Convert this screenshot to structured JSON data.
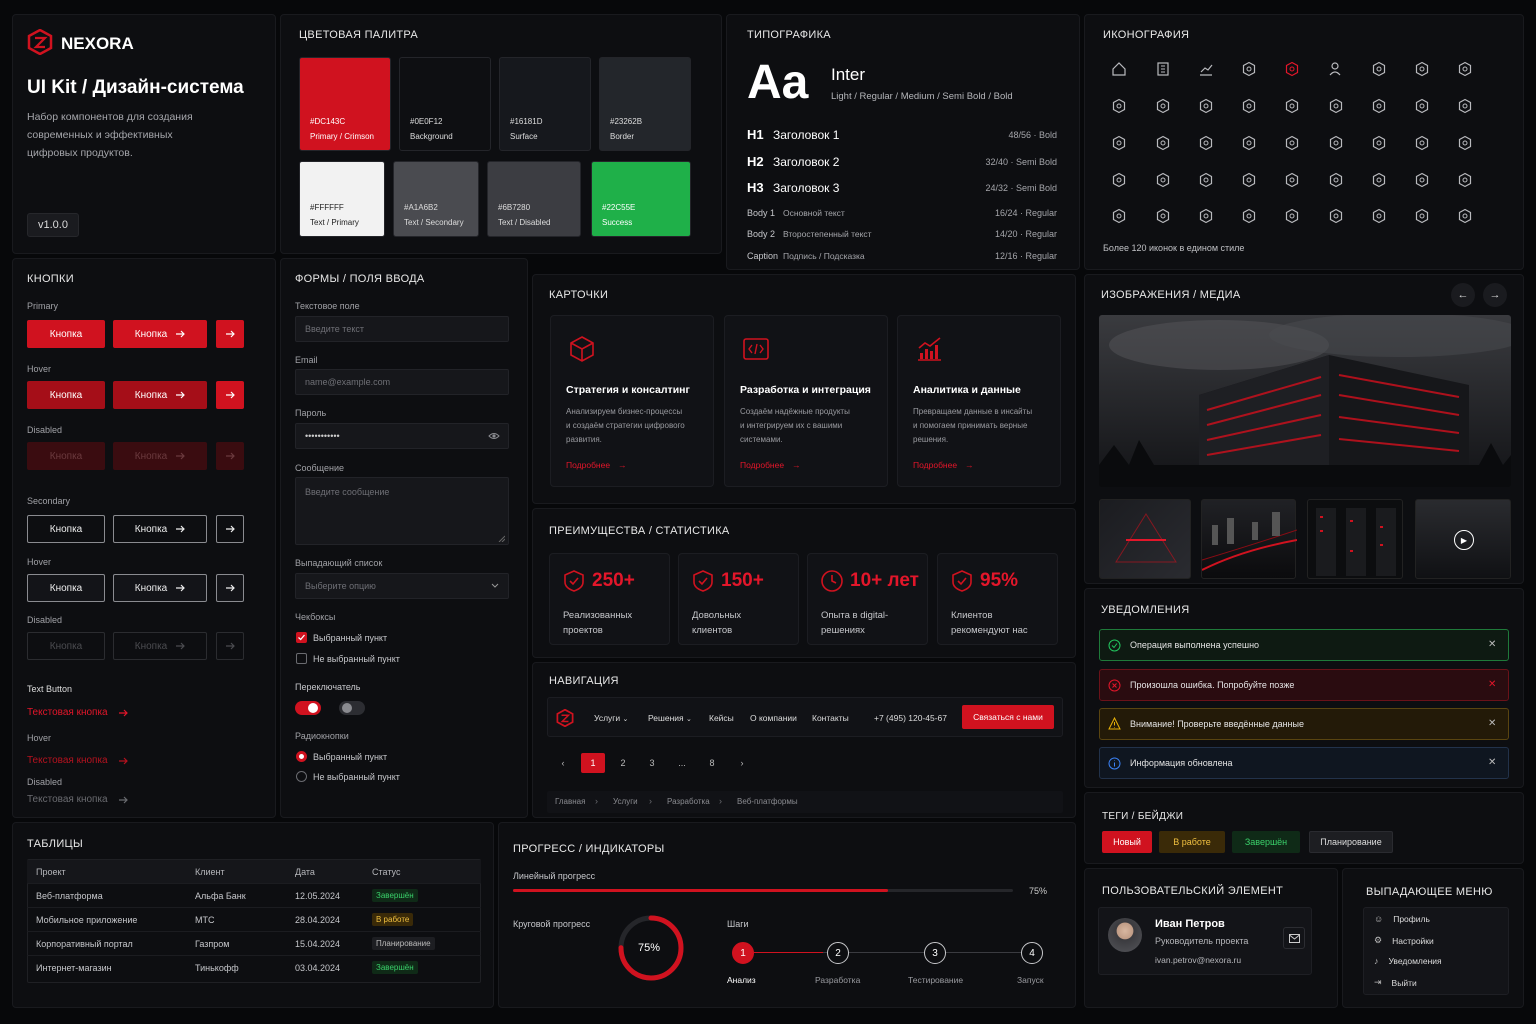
{
  "brand": {
    "name": "NEXORA",
    "title": "UI Kit / Дизайн-система",
    "description_lines": [
      "Набор компонентов для создания",
      "современных и эффективных",
      "цифровых продуктов."
    ],
    "version": "v1.0.0"
  },
  "palette": {
    "title": "ЦВЕТОВАЯ ПАЛИТРА",
    "swatches": [
      {
        "hex": "#DC143C",
        "name": "Primary / Crimson",
        "color": "#d0121f",
        "fg": "#fff"
      },
      {
        "hex": "#0E0F12",
        "name": "Background",
        "color": "#0e0f12",
        "fg": "#ddd"
      },
      {
        "hex": "#16181D",
        "name": "Surface",
        "color": "#16181d",
        "fg": "#ddd"
      },
      {
        "hex": "#23262B",
        "name": "Border",
        "color": "#23262b",
        "fg": "#ddd"
      },
      {
        "hex": "#FFFFFF",
        "name": "Text / Primary",
        "color": "#f2f2f2",
        "fg": "#222"
      },
      {
        "hex": "#A1A6B2",
        "name": "Text / Secondary",
        "color": "#4a4b50",
        "fg": "#ddd"
      },
      {
        "hex": "#6B7280",
        "name": "Text / Disabled",
        "color": "#3c3d42",
        "fg": "#ddd"
      },
      {
        "hex": "#22C55E",
        "name": "Success",
        "color": "#1fb049",
        "fg": "#fff"
      }
    ]
  },
  "typography": {
    "title": "ТИПОГРАФИКА",
    "sample": "Aa",
    "font": "Inter",
    "weights": "Light / Regular / Medium / Semi Bold / Bold",
    "rows": [
      {
        "tag": "H1",
        "text": "Заголовок 1",
        "size": "48/56",
        "weight": "Bold"
      },
      {
        "tag": "H2",
        "text": "Заголовок 2",
        "size": "32/40",
        "weight": "Semi Bold"
      },
      {
        "tag": "H3",
        "text": "Заголовок 3",
        "size": "24/32",
        "weight": "Semi Bold"
      },
      {
        "tag": "Body 1",
        "text": "Основной текст",
        "size": "16/24",
        "weight": "Regular"
      },
      {
        "tag": "Body 2",
        "text": "Второстепенный текст",
        "size": "14/20",
        "weight": "Regular"
      },
      {
        "tag": "Caption",
        "text": "Подпись / Подсказка",
        "size": "12/16",
        "weight": "Regular"
      }
    ]
  },
  "icons": {
    "title": "ИКОНОГРАФИЯ",
    "caption": "Более 120 иконок в едином стиле"
  },
  "buttons": {
    "title": "КНОПКИ",
    "primary": "Primary",
    "hover": "Hover",
    "disabled": "Disabled",
    "secondary": "Secondary",
    "text_button": "Text Button",
    "label": "Кнопка",
    "text_label": "Текстовая кнопка"
  },
  "forms": {
    "title": "ФОРМЫ / ПОЛЯ ВВОДА",
    "text_label": "Текстовое поле",
    "text_placeholder": "Введите текст",
    "email_label": "Email",
    "email_placeholder": "name@example.com",
    "password_label": "Пароль",
    "password_value": "•••••••••••",
    "message_label": "Сообщение",
    "message_placeholder": "Введите сообщение",
    "select_label": "Выпадающий список",
    "select_placeholder": "Выберите опцию",
    "checkbox_label": "Чекбоксы",
    "checked": "Выбранный пункт",
    "unchecked": "Не выбранный пункт",
    "switch_label": "Переключатель",
    "radio_label": "Радиокнопки"
  },
  "cards": {
    "title": "КАРТОЧКИ",
    "items": [
      {
        "title": "Стратегия и консалтинг",
        "lines": [
          "Анализируем бизнес-процессы",
          "и создаём стратегии цифрового",
          "развития."
        ],
        "link": "Подробнее"
      },
      {
        "title": "Разработка и интеграция",
        "lines": [
          "Создаём надёжные продукты",
          "и интегрируем их с вашими",
          "системами."
        ],
        "link": "Подробнее"
      },
      {
        "title": "Аналитика и данные",
        "lines": [
          "Превращаем данные в инсайты",
          "и помогаем принимать верные",
          "решения."
        ],
        "link": "Подробнее"
      }
    ]
  },
  "stats": {
    "title": "ПРЕИМУЩЕСТВА / СТАТИСТИКА",
    "items": [
      {
        "value": "250+",
        "l1": "Реализованных",
        "l2": "проектов"
      },
      {
        "value": "150+",
        "l1": "Довольных",
        "l2": "клиентов"
      },
      {
        "value": "10+ лет",
        "l1": "Опыта в digital-",
        "l2": "решениях"
      },
      {
        "value": "95%",
        "l1": "Клиентов",
        "l2": "рекомендуют нас"
      }
    ]
  },
  "navigation": {
    "title": "НАВИГАЦИЯ",
    "menu": [
      "Услуги",
      "Решения",
      "Кейсы",
      "О компании",
      "Контакты"
    ],
    "phone": "+7 (495) 120-45-67",
    "cta": "Связаться с нами",
    "pages": [
      "1",
      "2",
      "3",
      "...",
      "8"
    ],
    "breadcrumb": [
      "Главная",
      "Услуги",
      "Разработка",
      "Веб-платформы"
    ]
  },
  "media": {
    "title": "ИЗОБРАЖЕНИЯ / МЕДИА"
  },
  "notifications": {
    "title": "УВЕДОМЛЕНИЯ",
    "items": [
      {
        "text": "Операция выполнена успешно",
        "type": "success"
      },
      {
        "text": "Произошла ошибка. Попробуйте позже",
        "type": "error"
      },
      {
        "text": "Внимание! Проверьте введённые данные",
        "type": "warning"
      },
      {
        "text": "Информация обновлена",
        "type": "info"
      }
    ]
  },
  "tags": {
    "title": "ТЕГИ / БЕЙДЖИ",
    "items": [
      "Новый",
      "В работе",
      "Завершён",
      "Планирование"
    ]
  },
  "tables": {
    "title": "ТАБЛИЦЫ",
    "headers": [
      "Проект",
      "Клиент",
      "Дата",
      "Статус"
    ],
    "rows": [
      {
        "project": "Веб-платформа",
        "client": "Альфа Банк",
        "date": "12.05.2024",
        "status": "Завершён"
      },
      {
        "project": "Мобильное приложение",
        "client": "МТС",
        "date": "28.04.2024",
        "status": "В работе"
      },
      {
        "project": "Корпоративный портал",
        "client": "Газпром",
        "date": "15.04.2024",
        "status": "Планирование"
      },
      {
        "project": "Интернет-магазин",
        "client": "Тинькофф",
        "date": "03.04.2024",
        "status": "Завершён"
      }
    ]
  },
  "progress": {
    "title": "ПРОГРЕСС / ИНДИКАТОРЫ",
    "linear_label": "Линейный прогресс",
    "linear_value": "75%",
    "linear_fraction": 0.75,
    "circle_label": "Круговой прогресс",
    "circle_value": "75%",
    "steps_label": "Шаги",
    "steps": [
      {
        "n": "1",
        "label": "Анализ"
      },
      {
        "n": "2",
        "label": "Разработка"
      },
      {
        "n": "3",
        "label": "Тестирование"
      },
      {
        "n": "4",
        "label": "Запуск"
      }
    ]
  },
  "user": {
    "title": "ПОЛЬЗОВАТЕЛЬСКИЙ ЭЛЕМЕНТ",
    "name": "Иван Петров",
    "role": "Руководитель проекта",
    "email": "ivan.petrov@nexora.ru"
  },
  "dropdown": {
    "title": "ВЫПАДАЮЩЕЕ МЕНЮ",
    "items": [
      "Профиль",
      "Настройки",
      "Уведомления",
      "Выйти"
    ]
  }
}
